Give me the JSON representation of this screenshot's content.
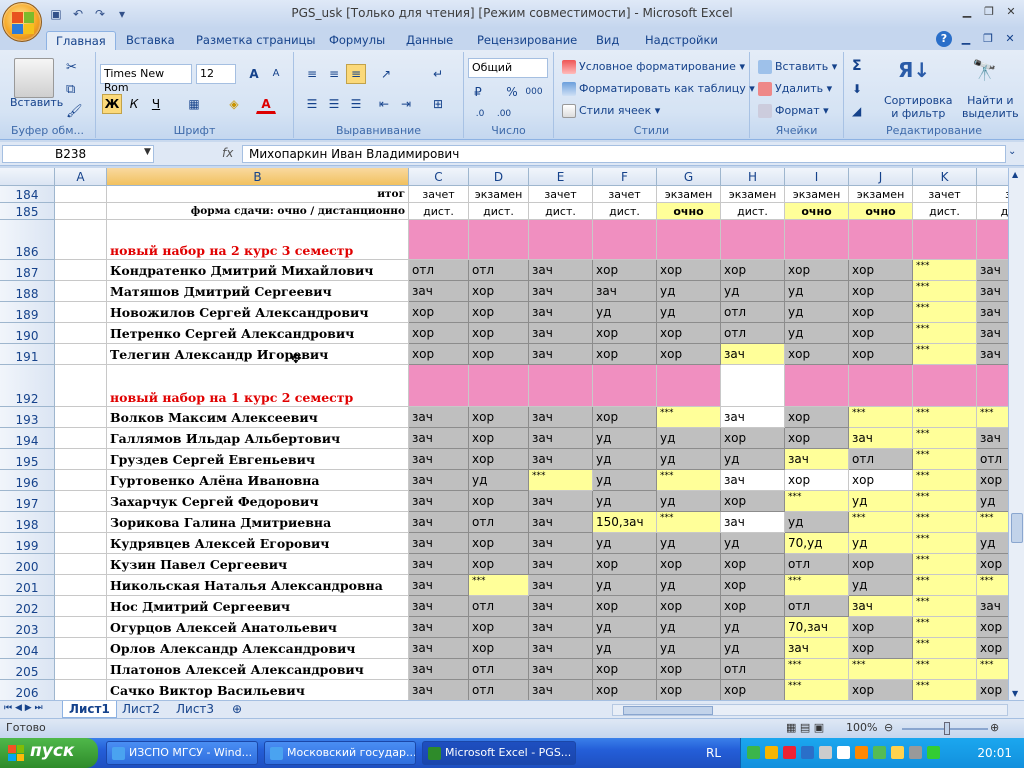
{
  "window": {
    "title": "PGS_usk  [Только для чтения]  [Режим совместимости] - Microsoft Excel"
  },
  "ribbon": {
    "tabs": [
      "Главная",
      "Вставка",
      "Разметка страницы",
      "Формулы",
      "Данные",
      "Рецензирование",
      "Вид",
      "Надстройки"
    ],
    "clipboard": {
      "paste": "Вставить",
      "label": "Буфер обм..."
    },
    "font": {
      "name": "Times New Rom",
      "size": "12",
      "label": "Шрифт",
      "bold": "Ж",
      "italic": "К",
      "underline": "Ч"
    },
    "alignment": {
      "label": "Выравнивание"
    },
    "number": {
      "format": "Общий",
      "label": "Число",
      "percent": "%",
      "thousands": "000"
    },
    "styles": {
      "conditional": "Условное форматирование",
      "as_table": "Форматировать как таблицу",
      "cell_styles": "Стили ячеек",
      "label": "Стили"
    },
    "cells": {
      "insert": "Вставить",
      "delete": "Удалить",
      "format": "Формат",
      "label": "Ячейки"
    },
    "editing": {
      "sort": "Сортировка и фильтр",
      "find": "Найти и выделить",
      "label": "Редактирование",
      "sort1": "Сортировка",
      "sort2": "и фильтр",
      "find1": "Найти и",
      "find2": "выделить",
      "sigma": "Σ"
    }
  },
  "formula_bar": {
    "name_box": "B238",
    "fx": "fx",
    "content": "Михопаркин Иван Владимирович"
  },
  "columns": [
    "A",
    "B",
    "C",
    "D",
    "E",
    "F",
    "G",
    "H",
    "I",
    "J",
    "K",
    ""
  ],
  "header_rows": [
    {
      "row": "184",
      "label": "итог",
      "values": [
        "зачет",
        "экзамен",
        "зачет",
        "зачет",
        "экзамен",
        "экзамен",
        "экзамен",
        "экзамен",
        "зачет",
        "з"
      ]
    },
    {
      "row": "185",
      "label": "форма сдачи: очно / дистанционно",
      "values": [
        "дист.",
        "дист.",
        "дист.",
        "дист.",
        "очно",
        "дист.",
        "очно",
        "очно",
        "дист.",
        "ди"
      ]
    }
  ],
  "rows": [
    {
      "row": "186",
      "section": "новый набор на 2 курс 3 семестр"
    },
    {
      "row": "187",
      "name": "Кондратенко Дмитрий Михайлович",
      "values": [
        "отл",
        "отл",
        "зач",
        "хор",
        "хор",
        "хор",
        "хор",
        "хор",
        "***",
        "зач"
      ]
    },
    {
      "row": "188",
      "name": "Матяшов Дмитрий Сергеевич",
      "values": [
        "зач",
        "хор",
        "зач",
        "зач",
        "уд",
        "уд",
        "уд",
        "хор",
        "***",
        "зач"
      ]
    },
    {
      "row": "189",
      "name": "Новожилов Сергей Александрович",
      "values": [
        "хор",
        "хор",
        "зач",
        "уд",
        "уд",
        "отл",
        "уд",
        "хор",
        "***",
        "зач"
      ]
    },
    {
      "row": "190",
      "name": "Петренко Сергей Александрович",
      "values": [
        "хор",
        "хор",
        "зач",
        "хор",
        "хор",
        "отл",
        "уд",
        "хор",
        "***",
        "зач"
      ]
    },
    {
      "row": "191",
      "name": "Телегин Александр Игоревич",
      "values": [
        "хор",
        "хор",
        "зач",
        "хор",
        "хор",
        "зач",
        "хор",
        "хор",
        "***",
        "зач"
      ]
    },
    {
      "row": "192",
      "section": "новый набор на 1 курс 2 семестр"
    },
    {
      "row": "193",
      "name": "Волков Максим Алексеевич",
      "values": [
        "зач",
        "хор",
        "зач",
        "хор",
        "***",
        "зач",
        "хор",
        "***",
        "***",
        "***"
      ]
    },
    {
      "row": "194",
      "name": "Галлямов Ильдар Альбертович",
      "values": [
        "зач",
        "хор",
        "зач",
        "уд",
        "уд",
        "хор",
        "хор",
        "зач",
        "***",
        "зач"
      ]
    },
    {
      "row": "195",
      "name": "Груздев Сергей Евгеньевич",
      "values": [
        "зач",
        "хор",
        "зач",
        "уд",
        "уд",
        "уд",
        "зач",
        "отл",
        "***",
        "отл"
      ]
    },
    {
      "row": "196",
      "name": "Гуртовенко Алёна Ивановна",
      "values": [
        "зач",
        "уд",
        "***",
        "уд",
        "***",
        "зач",
        "хор",
        "хор",
        "***",
        "хор"
      ]
    },
    {
      "row": "197",
      "name": "Захарчук Сергей Федорович",
      "values": [
        "зач",
        "хор",
        "зач",
        "уд",
        "уд",
        "хор",
        "***",
        "уд",
        "***",
        "уд"
      ]
    },
    {
      "row": "198",
      "name": "Зорикова Галина Дмитриевна",
      "values": [
        "зач",
        "отл",
        "зач",
        "150,зач",
        "***",
        "зач",
        "уд",
        "***",
        "***",
        "***"
      ]
    },
    {
      "row": "199",
      "name": "Кудрявцев Алексей Егорович",
      "values": [
        "зач",
        "хор",
        "зач",
        "уд",
        "уд",
        "уд",
        "70,уд",
        "уд",
        "***",
        "уд"
      ]
    },
    {
      "row": "200",
      "name": "Кузин Павел Сергеевич",
      "values": [
        "зач",
        "хор",
        "зач",
        "хор",
        "хор",
        "хор",
        "отл",
        "хор",
        "***",
        "хор"
      ]
    },
    {
      "row": "201",
      "name": "Никольская Наталья Александровна",
      "values": [
        "зач",
        "***",
        "зач",
        "уд",
        "уд",
        "хор",
        "***",
        "уд",
        "***",
        "***"
      ]
    },
    {
      "row": "202",
      "name": "Нос Дмитрий Сергеевич",
      "values": [
        "зач",
        "отл",
        "зач",
        "хор",
        "хор",
        "хор",
        "отл",
        "зач",
        "***",
        "зач"
      ]
    },
    {
      "row": "203",
      "name": "Огурцов Алексей Анатольевич",
      "values": [
        "зач",
        "хор",
        "зач",
        "уд",
        "уд",
        "уд",
        "70,зач",
        "хор",
        "***",
        "хор"
      ]
    },
    {
      "row": "204",
      "name": "Орлов Александр Александрович",
      "values": [
        "зач",
        "хор",
        "зач",
        "уд",
        "уд",
        "уд",
        "зач",
        "хор",
        "***",
        "хор"
      ]
    },
    {
      "row": "205",
      "name": "Платонов Алексей Александрович",
      "values": [
        "зач",
        "отл",
        "зач",
        "хор",
        "хор",
        "отл",
        "***",
        "***",
        "***",
        "***"
      ]
    },
    {
      "row": "206",
      "name": "Сачко Виктор Васильевич",
      "values": [
        "зач",
        "отл",
        "зач",
        "хор",
        "хор",
        "хор",
        "***",
        "хор",
        "***",
        "хор"
      ]
    }
  ],
  "sheets": [
    "Лист1",
    "Лист2",
    "Лист3"
  ],
  "status": {
    "ready": "Готово",
    "zoom": "100%"
  },
  "taskbar": {
    "start": "пуск",
    "tasks": [
      "ИЗСПО МГСУ - Wind...",
      "Московский государ...",
      "Microsoft Excel - PGS..."
    ],
    "lang": "RL",
    "clock": "20:01"
  }
}
